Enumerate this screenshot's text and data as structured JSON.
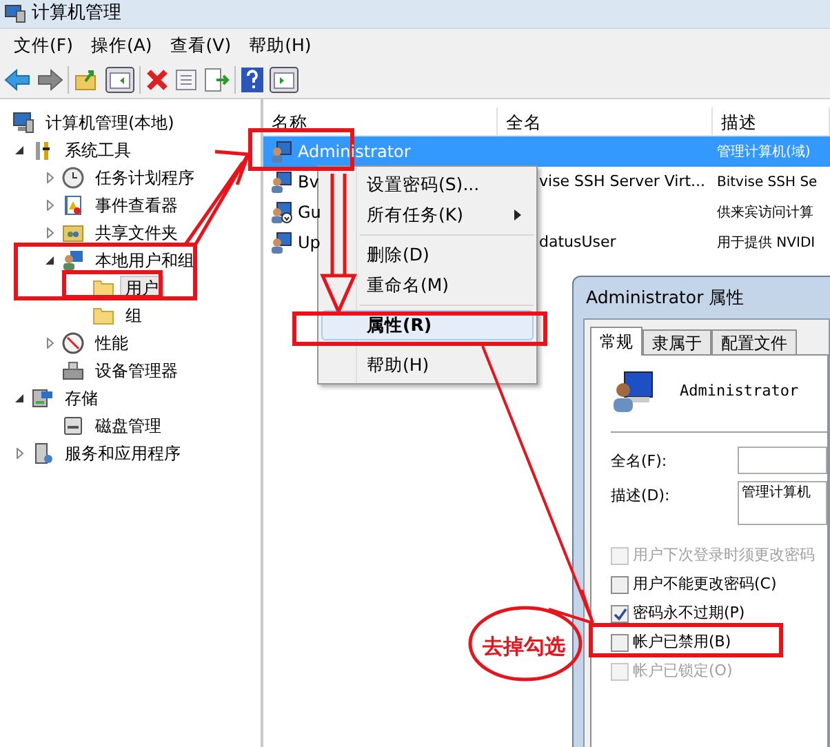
{
  "window": {
    "title": "计算机管理"
  },
  "menu": [
    "文件(F)",
    "操作(A)",
    "查看(V)",
    "帮助(H)"
  ],
  "tree": [
    {
      "label": "计算机管理(本地)",
      "kind": "computer",
      "selected": false,
      "children": [
        {
          "label": "系统工具",
          "kind": "tools",
          "expanded": true,
          "selected": false,
          "children": [
            {
              "label": "任务计划程序",
              "kind": "clock",
              "expanded": false,
              "selected": false
            },
            {
              "label": "事件查看器",
              "kind": "log",
              "expanded": false,
              "selected": false
            },
            {
              "label": "共享文件夹",
              "kind": "share",
              "expanded": false,
              "selected": false
            },
            {
              "label": "本地用户和组",
              "kind": "users",
              "expanded": true,
              "selected": false,
              "children": [
                {
                  "label": "用户",
                  "kind": "folder",
                  "selected": true
                },
                {
                  "label": "组",
                  "kind": "folder",
                  "selected": false
                }
              ]
            },
            {
              "label": "性能",
              "kind": "gauge",
              "expanded": false,
              "selected": false
            },
            {
              "label": "设备管理器",
              "kind": "device",
              "selected": false
            }
          ]
        },
        {
          "label": "存储",
          "kind": "storage",
          "expanded": true,
          "selected": false,
          "children": [
            {
              "label": "磁盘管理",
              "kind": "disk",
              "selected": false
            }
          ]
        },
        {
          "label": "服务和应用程序",
          "kind": "services",
          "expanded": false,
          "selected": false
        }
      ]
    }
  ],
  "list": {
    "columns": [
      "名称",
      "全名",
      "描述"
    ],
    "rows": [
      {
        "name": "Administrator",
        "description": "管理计算机(域)",
        "selected": true,
        "disabled": false
      },
      {
        "name": "Bv",
        "full_name": "vise SSH Server Virt...",
        "description": "Bitvise SSH Se",
        "selected": false,
        "disabled": false
      },
      {
        "name": "Gu",
        "description": "供来宾访问计算",
        "selected": false,
        "disabled": true
      },
      {
        "name": "Up",
        "full_name": "datusUser",
        "description": "用于提供 NVIDI",
        "selected": false,
        "disabled": false
      }
    ]
  },
  "context_menu": [
    {
      "label": "设置密码(S)...",
      "selected": false,
      "submenu": false,
      "group_start": false
    },
    {
      "label": "所有任务(K)",
      "selected": false,
      "submenu": true,
      "group_start": false
    },
    {
      "label": "删除(D)",
      "selected": false,
      "submenu": false,
      "group_start": true
    },
    {
      "label": "重命名(M)",
      "selected": false,
      "submenu": false,
      "group_start": false
    },
    {
      "label": "属性(R)",
      "selected": true,
      "submenu": false,
      "group_start": true
    },
    {
      "label": "帮助(H)",
      "selected": false,
      "submenu": false,
      "group_start": true
    }
  ],
  "dialog": {
    "title": "Administrator 属性",
    "tabs": [
      {
        "label": "常规",
        "selected": true
      },
      {
        "label": "隶属于",
        "selected": false
      },
      {
        "label": "配置文件",
        "selected": false
      }
    ],
    "user_name": "Administrator",
    "fields": [
      {
        "label": "全名(F):"
      },
      {
        "label": "描述(D):",
        "value": "管理计算机"
      }
    ],
    "checkboxes": [
      {
        "label": "用户下次登录时须更改密码",
        "checked": false,
        "disabled": true
      },
      {
        "label": "用户不能更改密码(C)",
        "checked": false,
        "disabled": false
      },
      {
        "label": "密码永不过期(P)",
        "checked": true,
        "disabled": false
      },
      {
        "label": "帐户已禁用(B)",
        "checked": false,
        "disabled": false
      },
      {
        "label": "帐户已锁定(O)",
        "checked": false,
        "disabled": true
      }
    ]
  },
  "annotation": {
    "label": "去掉勾选"
  }
}
